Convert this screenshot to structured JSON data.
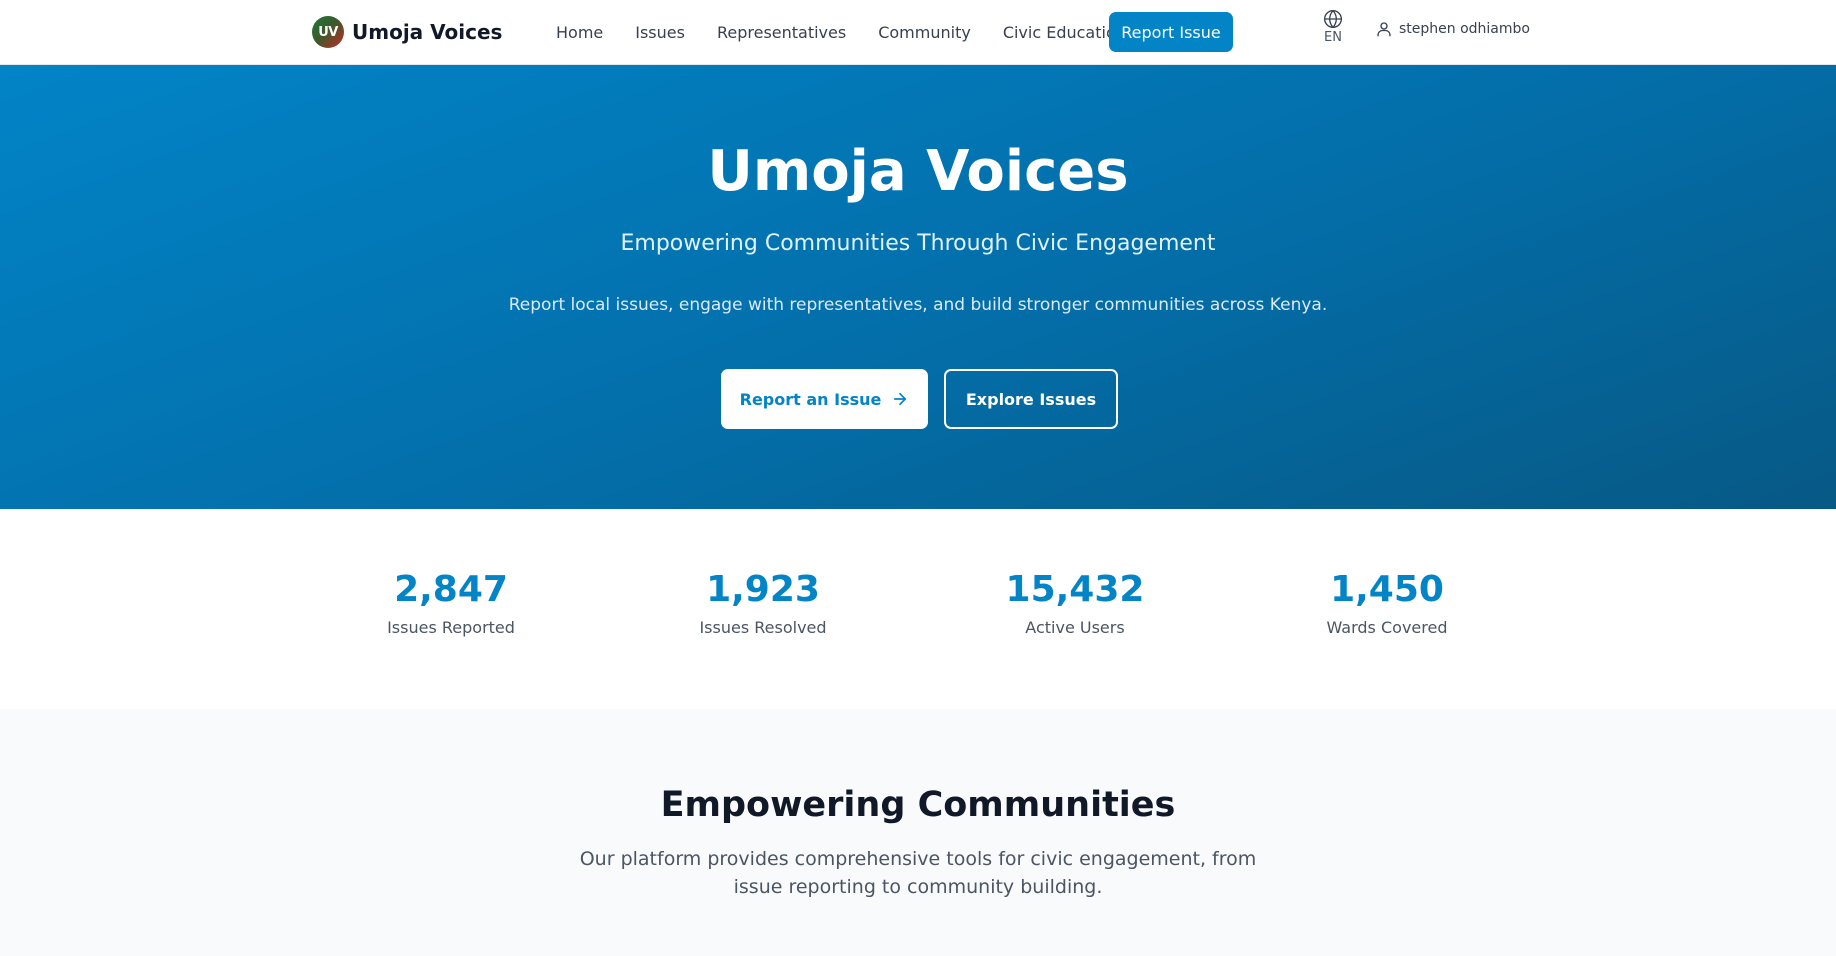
{
  "header": {
    "logo_initials": "UV",
    "brand": "Umoja Voices",
    "nav": [
      "Home",
      "Issues",
      "Representatives",
      "Community",
      "Civic Education"
    ],
    "cta": "Report Issue",
    "language": "EN",
    "language_icon": "globe-icon",
    "user_icon": "user-icon",
    "user_name": "stephen odhiambo"
  },
  "hero": {
    "title": "Umoja Voices",
    "subtitle": "Empowering Communities Through Civic Engagement",
    "description": "Report local issues, engage with representatives, and build stronger communities across Kenya.",
    "primary_button": "Report an Issue",
    "primary_button_icon": "arrow-right-icon",
    "secondary_button": "Explore Issues"
  },
  "stats": [
    {
      "value": "2,847",
      "label": "Issues Reported"
    },
    {
      "value": "1,923",
      "label": "Issues Resolved"
    },
    {
      "value": "15,432",
      "label": "Active Users"
    },
    {
      "value": "1,450",
      "label": "Wards Covered"
    }
  ],
  "features": {
    "title": "Empowering Communities",
    "description": "Our platform provides comprehensive tools for civic engagement, from issue reporting to community building."
  },
  "colors": {
    "primary": "#0284c7",
    "hero_gradient_start": "#0284c7",
    "hero_gradient_end": "#075985",
    "section_background": "#f8fafc"
  }
}
